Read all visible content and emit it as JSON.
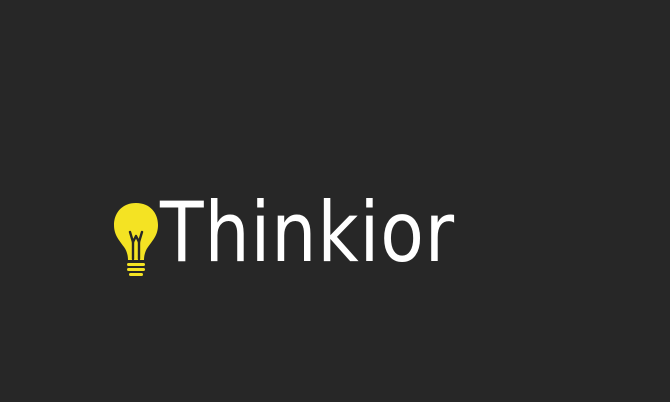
{
  "logo": {
    "brand_name": "Thinkior",
    "icon": "lightbulb-icon"
  },
  "colors": {
    "background": "#272727",
    "text": "#ffffff",
    "bulb": "#f4e323",
    "bulb_lines": "#272727"
  }
}
